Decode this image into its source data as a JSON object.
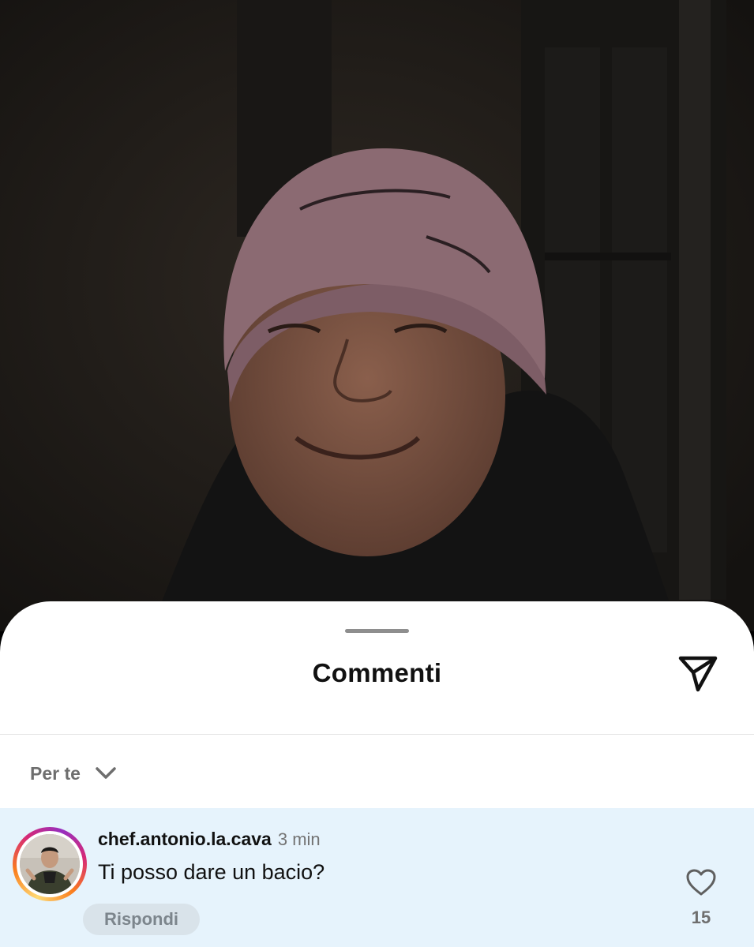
{
  "sheet": {
    "title": "Commenti",
    "share_icon": "paper-plane-icon"
  },
  "sort": {
    "label": "Per te",
    "icon": "chevron-down-icon"
  },
  "comments": [
    {
      "username": "chef.antonio.la.cava",
      "time": "3 min",
      "text": "Ti posso dare un bacio?",
      "reply_label": "Rispondi",
      "like_icon": "heart-outline-icon",
      "like_count": "15",
      "highlighted": true
    }
  ],
  "colors": {
    "sheet_bg": "#ffffff",
    "highlight_bg": "#e6f3fc",
    "text_primary": "#111111",
    "text_secondary": "#737373"
  }
}
